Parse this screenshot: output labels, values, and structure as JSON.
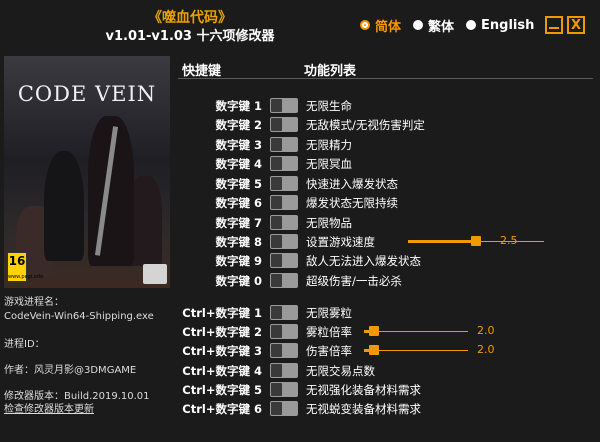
{
  "header": {
    "game_title": "《噬血代码》",
    "version_title": "v1.01-v1.03 十六项修改器"
  },
  "languages": [
    {
      "label": "简体",
      "selected": true
    },
    {
      "label": "繁体",
      "selected": false
    },
    {
      "label": "English",
      "selected": false
    }
  ],
  "window_controls": {
    "minimize_icon": "minimize-icon",
    "close_icon": "close-icon",
    "close_label": "X"
  },
  "colors": {
    "accent": "#f39800",
    "title": "#e8a100",
    "background": "#1b1b1b"
  },
  "cover": {
    "logo_text": "CODE VEIN",
    "rating_number": "16",
    "rating_sub": "www.pegi.info"
  },
  "info": {
    "process_label": "游戏进程名：",
    "process_name": "CodeVein-Win64-Shipping.exe",
    "pid_label": "进程ID：",
    "author": "作者：风灵月影@3DMGAME",
    "build": "修改器版本：Build.2019.10.01",
    "check_update": "检查修改器版本更新"
  },
  "columns": {
    "hotkey": "快捷键",
    "function": "功能列表"
  },
  "cheats": [
    {
      "key": "数字键 1",
      "label": "无限生命"
    },
    {
      "key": "数字键 2",
      "label": "无敌模式/无视伤害判定"
    },
    {
      "key": "数字键 3",
      "label": "无限精力"
    },
    {
      "key": "数字键 4",
      "label": "无限冥血"
    },
    {
      "key": "数字键 5",
      "label": "快速进入爆发状态"
    },
    {
      "key": "数字键 6",
      "label": "爆发状态无限持续"
    },
    {
      "key": "数字键 7",
      "label": "无限物品"
    },
    {
      "key": "数字键 8",
      "label": "设置游戏速度",
      "slider": {
        "value": "2.5",
        "fraction": 0.5
      }
    },
    {
      "key": "数字键 9",
      "label": "敌人无法进入爆发状态"
    },
    {
      "key": "数字键 0",
      "label": "超级伤害/一击必杀"
    },
    {
      "key": "Ctrl+数字键 1",
      "label": "无限雾粒"
    },
    {
      "key": "Ctrl+数字键 2",
      "label": "雾粒倍率",
      "slider": {
        "value": "2.0",
        "fraction": 0.1
      }
    },
    {
      "key": "Ctrl+数字键 3",
      "label": "伤害倍率",
      "slider": {
        "value": "2.0",
        "fraction": 0.1
      }
    },
    {
      "key": "Ctrl+数字键 4",
      "label": "无限交易点数"
    },
    {
      "key": "Ctrl+数字键 5",
      "label": "无视强化装备材料需求"
    },
    {
      "key": "Ctrl+数字键 6",
      "label": "无视蜕变装备材料需求"
    }
  ]
}
